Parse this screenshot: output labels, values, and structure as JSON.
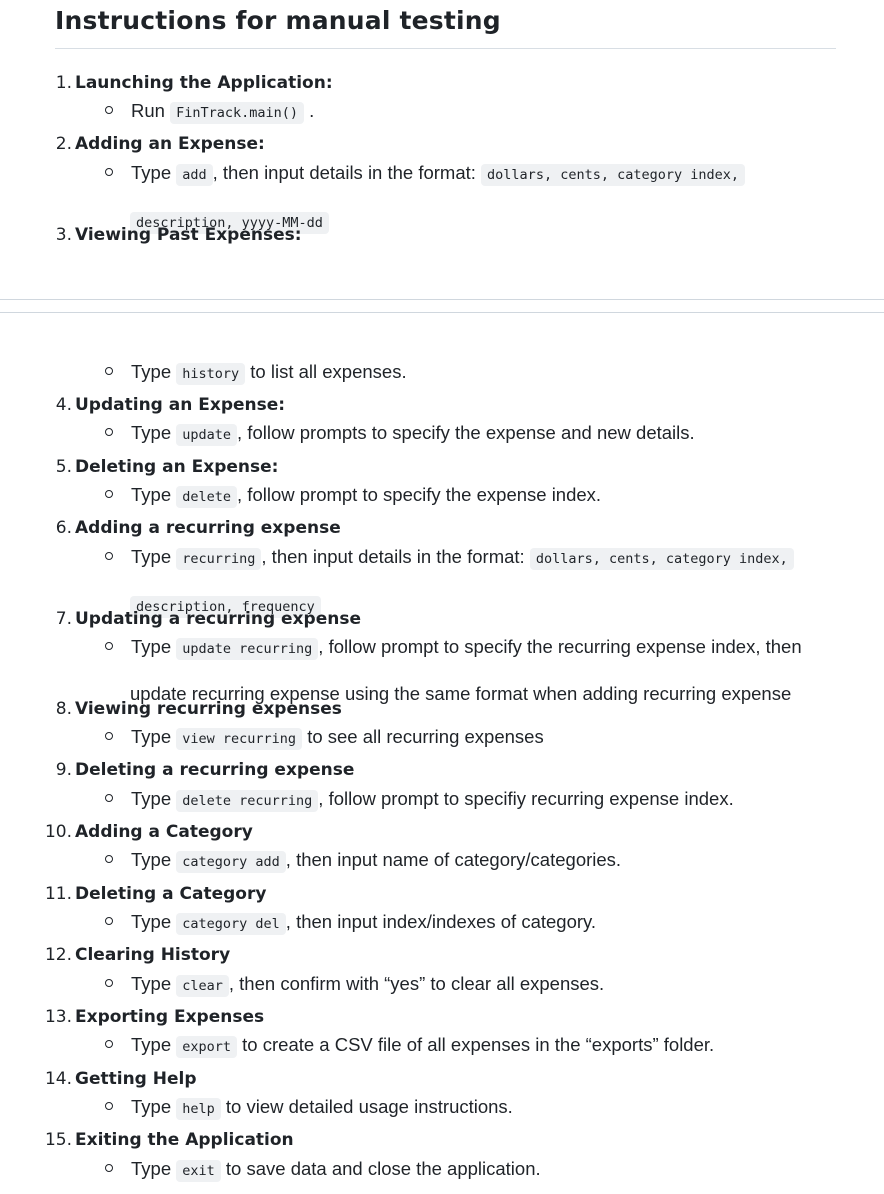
{
  "title": "Instructions for manual testing",
  "steps": [
    {
      "num": "1.",
      "title": "Launching the Application:",
      "detail": {
        "pre": "Run",
        "code": "FinTrack.main()",
        "post": "."
      }
    },
    {
      "num": "2.",
      "title": "Adding an Expense:",
      "detail": {
        "pre": "Type",
        "code": "add",
        "mid": ", then input details in the format:",
        "code2": "dollars, cents, category index,",
        "cont": "description, yyyy-MM-dd"
      }
    },
    {
      "num": "3.",
      "title": "Viewing Past Expenses:",
      "detail": {
        "pre": "Type",
        "code": "history",
        "post": "to list all expenses."
      }
    },
    {
      "num": "4.",
      "title": "Updating an Expense:",
      "detail": {
        "pre": "Type",
        "code": "update",
        "post": ", follow prompts to specify the expense and new details."
      }
    },
    {
      "num": "5.",
      "title": "Deleting an Expense:",
      "detail": {
        "pre": "Type",
        "code": "delete",
        "post": ", follow prompt to specify the expense index."
      }
    },
    {
      "num": "6.",
      "title": "Adding a recurring expense",
      "detail": {
        "pre": "Type",
        "code": "recurring",
        "mid": ", then input details in the format:",
        "code2": "dollars, cents, category index,",
        "cont": "description, frequency"
      }
    },
    {
      "num": "7.",
      "title": "Updating a recurring expense",
      "detail": {
        "pre": "Type",
        "code": "update recurring",
        "post": ", follow prompt to specify the recurring expense index, then",
        "cont": "update recurring expense using the same format when adding recurring expense"
      }
    },
    {
      "num": "8.",
      "title": "Viewing recurring expenses",
      "detail": {
        "pre": "Type",
        "code": "view recurring",
        "post": "to see all recurring expenses"
      }
    },
    {
      "num": "9.",
      "title": "Deleting a recurring expense",
      "detail": {
        "pre": "Type",
        "code": "delete recurring",
        "post": ", follow prompt to specifiy recurring expense index."
      }
    },
    {
      "num": "10.",
      "title": "Adding a Category",
      "detail": {
        "pre": "Type",
        "code": "category add",
        "post": ", then input name of category/categories."
      }
    },
    {
      "num": "11.",
      "title": "Deleting a Category",
      "detail": {
        "pre": "Type",
        "code": "category del",
        "post": ", then input index/indexes of category."
      }
    },
    {
      "num": "12.",
      "title": "Clearing History",
      "detail": {
        "pre": "Type",
        "code": "clear",
        "post": ", then confirm with “yes” to clear all expenses."
      }
    },
    {
      "num": "13.",
      "title": "Exporting Expenses",
      "detail": {
        "pre": "Type",
        "code": "export",
        "post": "to create a CSV file of all expenses in the “exports” folder."
      }
    },
    {
      "num": "14.",
      "title": "Getting Help",
      "detail": {
        "pre": "Type",
        "code": "help",
        "post": "to view detailed usage instructions."
      }
    },
    {
      "num": "15.",
      "title": "Exiting the Application",
      "detail": {
        "pre": "Type",
        "code": "exit",
        "post": "to save data and close the application."
      }
    }
  ]
}
